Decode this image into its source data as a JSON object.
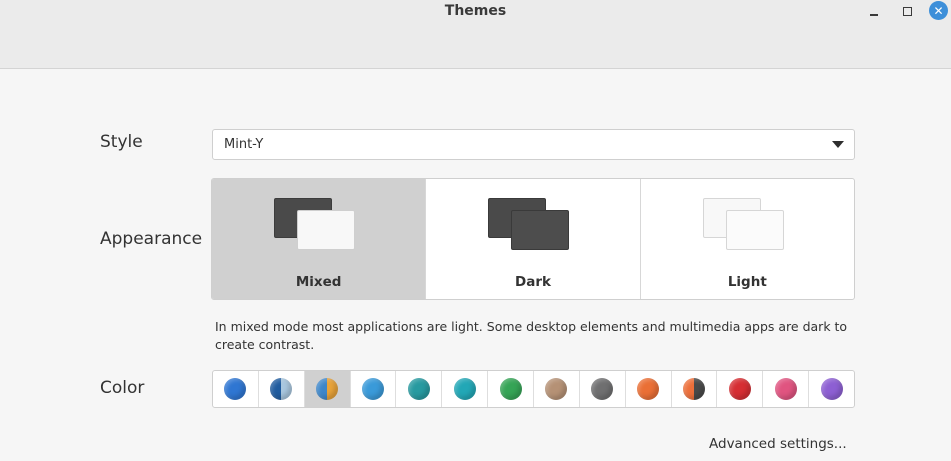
{
  "window": {
    "title": "Themes",
    "minimize_icon": "minimize-icon",
    "maximize_icon": "maximize-icon",
    "close_icon": "close-icon",
    "close_glyph": "✕"
  },
  "style": {
    "label": "Style",
    "value": "Mint-Y"
  },
  "appearance": {
    "label": "Appearance",
    "options": [
      {
        "label": "Mixed",
        "selected": true
      },
      {
        "label": "Dark",
        "selected": false
      },
      {
        "label": "Light",
        "selected": false
      }
    ],
    "description": "In mixed mode most applications are light. Some desktop elements and multimedia apps are dark to create contrast."
  },
  "color": {
    "label": "Color",
    "swatches": [
      {
        "id": "blue",
        "colors": [
          "#2f76d2"
        ],
        "selected": false
      },
      {
        "id": "aqua-split",
        "colors": [
          "#1f5b9e",
          "#a9c7df"
        ],
        "selected": false
      },
      {
        "id": "orange-split",
        "colors": [
          "#3d86c9",
          "#e8a33a"
        ],
        "selected": true
      },
      {
        "id": "sky",
        "colors": [
          "#3a9ad9"
        ],
        "selected": false
      },
      {
        "id": "teal",
        "colors": [
          "#279aa0"
        ],
        "selected": false
      },
      {
        "id": "cyan",
        "colors": [
          "#22a7b6"
        ],
        "selected": false
      },
      {
        "id": "green",
        "colors": [
          "#35a456"
        ],
        "selected": false
      },
      {
        "id": "sand",
        "colors": [
          "#b59175"
        ],
        "selected": false
      },
      {
        "id": "grey",
        "colors": [
          "#6f6f70"
        ],
        "selected": false
      },
      {
        "id": "orange",
        "colors": [
          "#ea6f35"
        ],
        "selected": false
      },
      {
        "id": "red-split",
        "colors": [
          "#ec6f3a",
          "#4a4a4a"
        ],
        "selected": false
      },
      {
        "id": "red",
        "colors": [
          "#d62e33"
        ],
        "selected": false
      },
      {
        "id": "pink",
        "colors": [
          "#e05480"
        ],
        "selected": false
      },
      {
        "id": "purple",
        "colors": [
          "#8d5fd3"
        ],
        "selected": false
      }
    ]
  },
  "advanced": {
    "label": "Advanced settings..."
  }
}
